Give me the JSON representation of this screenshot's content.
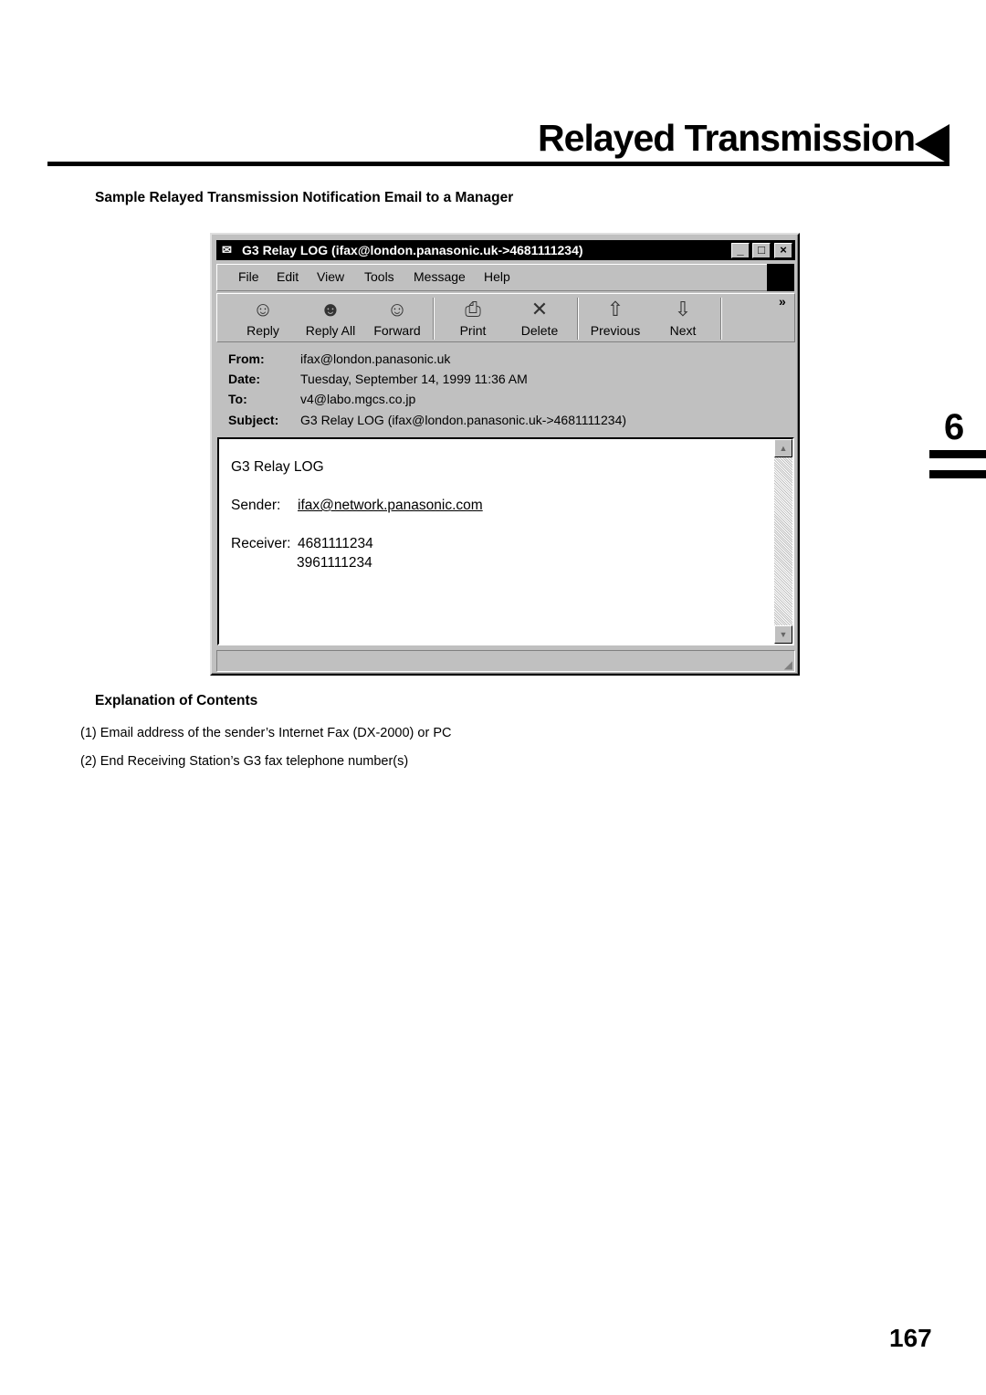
{
  "page": {
    "title": "Relayed Transmission",
    "subtitle": "Sample Relayed Transmission Notification Email to a Manager",
    "chapter": "6",
    "page_number": "167"
  },
  "window": {
    "title": "G3 Relay LOG (ifax@london.panasonic.uk->4681111234)",
    "menu": [
      "File",
      "Edit",
      "View",
      "Tools",
      "Message",
      "Help"
    ],
    "toolbar": [
      {
        "label": "Reply",
        "icon": "reply-icon"
      },
      {
        "label": "Reply All",
        "icon": "reply-all-icon"
      },
      {
        "label": "Forward",
        "icon": "forward-icon"
      },
      {
        "label": "Print",
        "icon": "print-icon"
      },
      {
        "label": "Delete",
        "icon": "delete-icon"
      },
      {
        "label": "Previous",
        "icon": "arrow-up-icon"
      },
      {
        "label": "Next",
        "icon": "arrow-down-icon"
      }
    ],
    "more": "»",
    "headers": [
      {
        "label": "From:",
        "value": "ifax@london.panasonic.uk"
      },
      {
        "label": "Date:",
        "value": "Tuesday, September 14, 1999 11:36 AM"
      },
      {
        "label": "To:",
        "value": "v4@labo.mgcs.co.jp"
      },
      {
        "label": "Subject:",
        "value": "G3 Relay LOG (ifax@london.panasonic.uk->4681111234)"
      }
    ],
    "body": {
      "heading": "G3 Relay LOG",
      "sender_label": "Sender:",
      "sender": "ifax@network.panasonic.com",
      "receiver_label": "Receiver:",
      "receivers": [
        "4681111234",
        "3961111234"
      ]
    }
  },
  "explanation": {
    "heading": "Explanation of Contents",
    "items": [
      {
        "num": "(1)",
        "text": "Email address of the sender’s Internet Fax (DX-2000) or PC"
      },
      {
        "num": "(2)",
        "text": "End Receiving Station’s G3 fax telephone number(s)"
      }
    ]
  }
}
